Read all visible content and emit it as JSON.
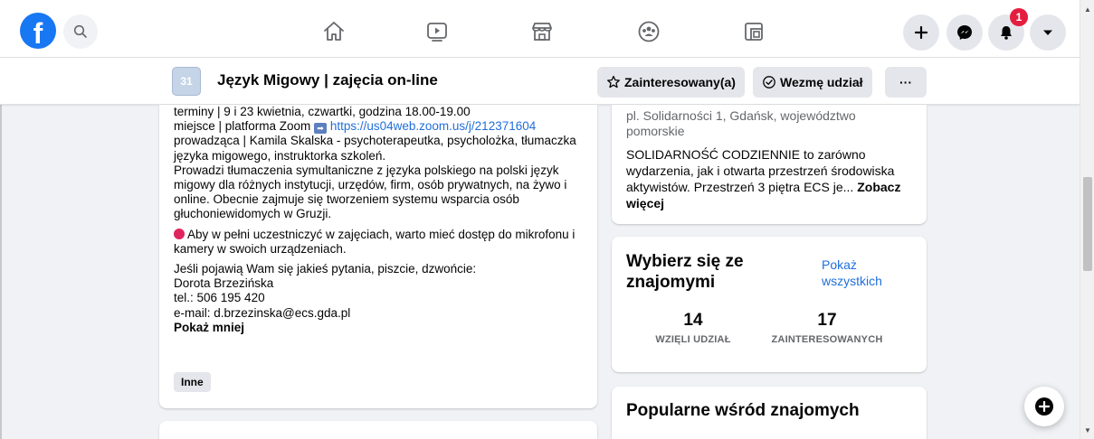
{
  "nav": {
    "logo": "f",
    "icons": [
      "search-icon",
      "home-icon",
      "watch-icon",
      "marketplace-icon",
      "groups-icon",
      "gaming-icon"
    ],
    "right_buttons": [
      "plus-icon",
      "messenger-icon",
      "bell-icon",
      "caret-down-icon"
    ],
    "notification_count": "1"
  },
  "event": {
    "calendar_day": "31",
    "title": "Język Migowy | zajęcia on-line",
    "interested_label": "Zainteresowany(a)",
    "going_label": "Wezmę udział",
    "more_label": "···"
  },
  "description": {
    "line1": "terminy | 9 i 23 kwietnia, czwartki, godzina 18.00-19.00",
    "place_prefix": "miejsce | platforma Zoom",
    "link": "https://us04web.zoom.us/j/212371604",
    "host": "prowadząca | Kamila Skalska - psychoterapeutka, psycholożka, tłumaczka języka migowego, instruktorka szkoleń.",
    "bio": "Prowadzi tłumaczenia symultaniczne z języka polskiego na polski język migowy dla różnych instytucji, urzędów, firm, osób prywatnych, na żywo i online. Obecnie zajmuje się tworzeniem systemu wsparcia osób głuchoniewidomych w Gruzji.",
    "requirement": "Aby w pełni uczestniczyć w zajęciach, warto mieć dostęp do mikrofonu i kamery w swoich urządzeniach.",
    "contact_intro": "Jeśli pojawią Wam się jakieś pytania, piszcie, dzwońcie:",
    "contact_name": "Dorota Brzezińska",
    "contact_tel": "tel.: 506 195 420",
    "contact_email": "e-mail: d.brzezinska@ecs.gda.pl",
    "show_less": "Pokaż mniej",
    "tag": "Inne"
  },
  "location": {
    "address": "pl. Solidarności 1, Gdańsk, województwo pomorskie",
    "desc": "SOLIDARNOŚĆ CODZIENNIE to zarówno wydarzenia, jak i otwarta przestrzeń środowiska aktywistów. Przestrzeń 3 piętra ECS je...",
    "see_more": "Zobacz więcej"
  },
  "friends": {
    "title": "Wybierz się ze znajomymi",
    "show_all": "Pokaż wszystkich",
    "went_count": "14",
    "went_label": "WZIĘLI UDZIAŁ",
    "interested_count": "17",
    "interested_label": "ZAINTERESOWANYCH"
  },
  "popular": {
    "title": "Popularne wśród znajomych"
  },
  "colors": {
    "brand": "#1877f2",
    "link": "#216fdb",
    "badge": "#e41e3f"
  }
}
